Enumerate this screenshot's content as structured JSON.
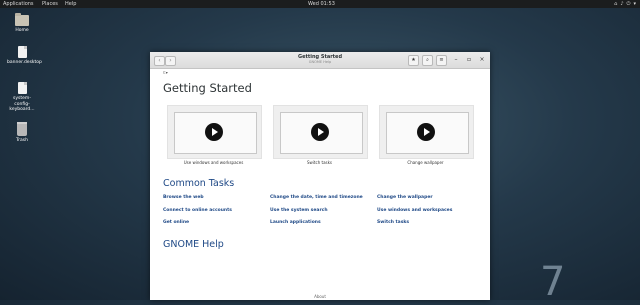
{
  "topbar": {
    "applications": "Applications",
    "places": "Places",
    "help": "Help",
    "clock": "Wed 01:53"
  },
  "desktop": {
    "icons": [
      {
        "label": "Home"
      },
      {
        "label": "banner.desktop"
      },
      {
        "label": "system-config-keyboard..."
      },
      {
        "label": "Trash"
      }
    ]
  },
  "window": {
    "title": "Getting Started",
    "subtitle": "GNOME Help",
    "language_button": "",
    "heading": "Getting Started",
    "videos": [
      {
        "caption": "Use windows and workspaces"
      },
      {
        "caption": "Switch tasks"
      },
      {
        "caption": "Change wallpaper"
      }
    ],
    "common_tasks_heading": "Common Tasks",
    "tasks": [
      [
        "Browse the web",
        "Change the date, time and timezone",
        "Change the wallpaper"
      ],
      [
        "Connect to online accounts",
        "Use the system search",
        "Use windows and workspaces"
      ],
      [
        "Get online",
        "Launch applications",
        "Switch tasks"
      ]
    ],
    "gnome_help_heading": "GNOME Help",
    "footer": "About"
  },
  "colors": {
    "accent": "#204a87",
    "desktop_bg": "#24394a"
  },
  "wallpaper_mark": "7"
}
